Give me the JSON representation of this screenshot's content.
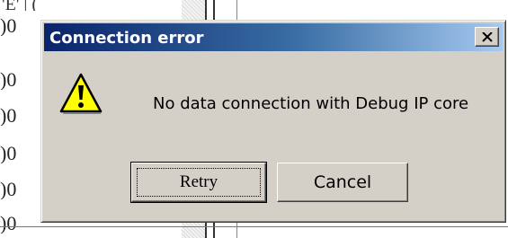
{
  "background": {
    "left_fragments": [
      ")0",
      ")0",
      ")0",
      ")0",
      ")0",
      ")0"
    ],
    "top_fragment": "'E' | ("
  },
  "dialog": {
    "title": "Connection error",
    "message": "No data connection with Debug IP core",
    "icon": "warning-icon",
    "buttons": {
      "retry_label": "Retry",
      "cancel_label": "Cancel"
    },
    "colors": {
      "titlebar_start": "#0a246a",
      "titlebar_end": "#a6caf0",
      "face": "#d4d0c8",
      "warning": "#ffff00"
    }
  }
}
